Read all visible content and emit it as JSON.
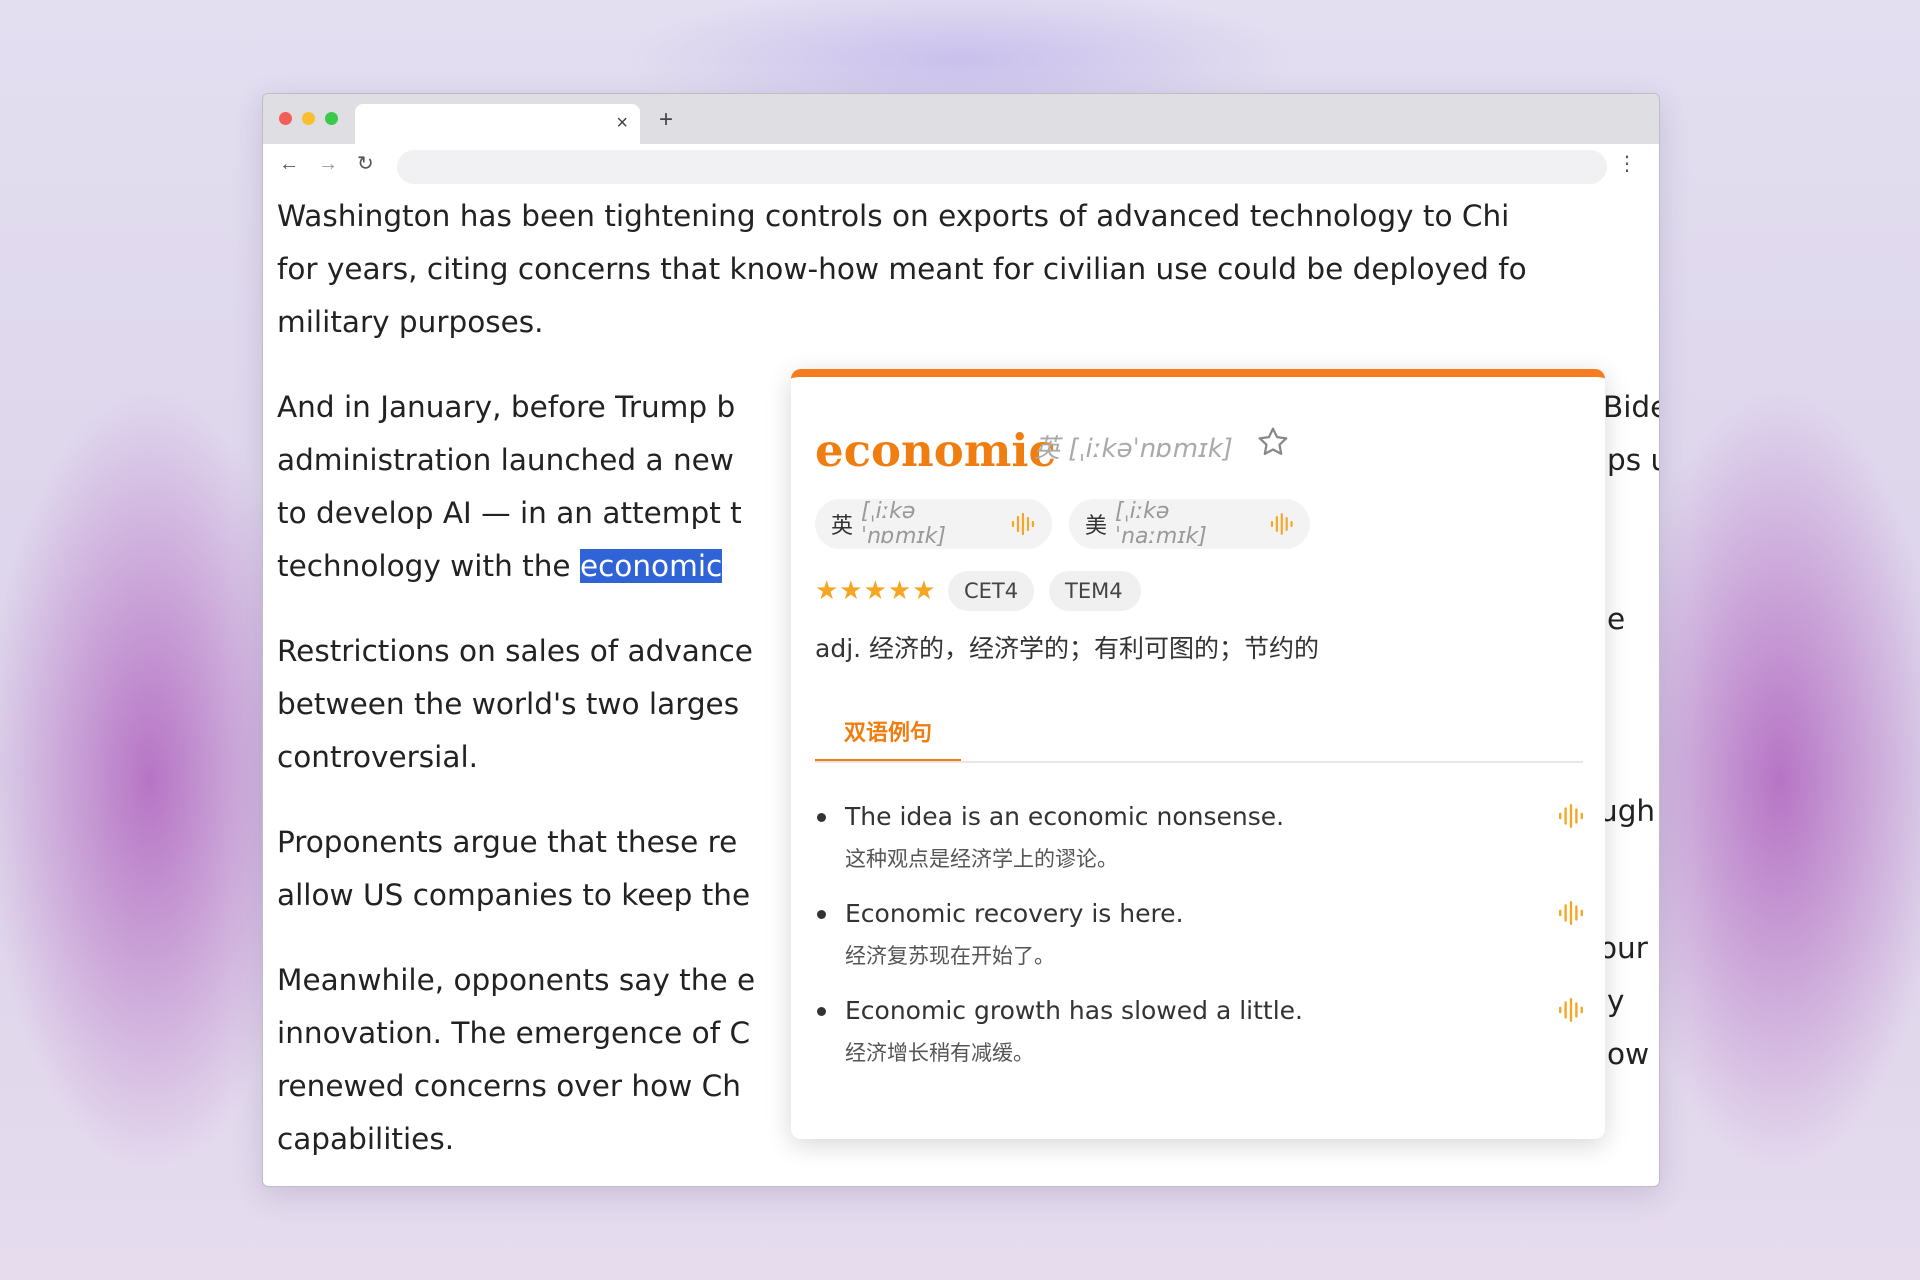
{
  "browser": {
    "tab_close": "×",
    "new_tab": "+",
    "back": "←",
    "forward": "→",
    "reload": "↻",
    "menu": "⋮",
    "url": ""
  },
  "article": {
    "paragraphs": [
      [
        "Washington has been tightening controls on exports of advanced technology to Chi",
        "for years, citing concerns that know-how meant for civilian use could be deployed fo",
        "military purposes."
      ],
      [
        "And in January, before Trump b",
        "administration launched a new",
        "to develop AI — in an attempt t",
        "technology with the "
      ],
      [
        "Restrictions on sales of advance",
        "between the world's two larges",
        "controversial."
      ],
      [
        "Proponents argue that these re",
        "allow US companies to keep the"
      ],
      [
        "Meanwhile, opponents say the e",
        "innovation. The emergence of C",
        "renewed concerns over how Ch",
        "capabilities."
      ]
    ],
    "selected_word": "economic",
    "right_fragments": [
      "Bide",
      "ps u",
      "e",
      "ugh",
      "our",
      "y",
      "ow"
    ]
  },
  "popup": {
    "word": "economic",
    "head_phonetic": "英 [ˌiːkəˈnɒmɪk]",
    "uk_label": "英",
    "uk_phonetic": "[ˌiːkəˈnɒmɪk]",
    "us_label": "美",
    "us_phonetic": "[ˌiːkəˈnaːmɪk]",
    "stars": "★★★★★",
    "rating": 5,
    "tags": [
      "CET4",
      "TEM4"
    ],
    "definition": "adj. 经济的，经济学的；有利可图的；节约的",
    "tab_label": "双语例句",
    "examples": [
      {
        "en": "The idea is an economic nonsense.",
        "zh": "这种观点是经济学上的谬论。"
      },
      {
        "en": "Economic recovery is here.",
        "zh": "经济复苏现在开始了。"
      },
      {
        "en": "Economic growth has slowed a little.",
        "zh": "经济增长稍有减缓。"
      }
    ],
    "colors": {
      "accent": "#f07d10",
      "stars": "#f5a623",
      "selection": "#2f63d6"
    },
    "icons": [
      "star-outline-icon",
      "audio-wave-icon"
    ]
  }
}
